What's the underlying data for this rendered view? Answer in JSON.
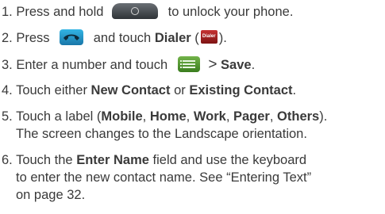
{
  "steps": [
    {
      "number": "1.",
      "before": "Press and hold",
      "after": "to unlock your phone.",
      "icon": "unlock-button-icon"
    },
    {
      "number": "2.",
      "before": "Press",
      "middle": "and touch",
      "bold": "Dialer",
      "paren_open": "(",
      "icon_label": "Dialer",
      "paren_close": ").",
      "icon": "phone-call-icon"
    },
    {
      "number": "3.",
      "before": "Enter a number and touch",
      "gt": ">",
      "bold": "Save",
      "period": ".",
      "icon": "menu-icon"
    },
    {
      "number": "4.",
      "before": "Touch either",
      "bold1": "New Contact",
      "middle": "or",
      "bold2": "Existing Contact",
      "period": "."
    },
    {
      "number": "5.",
      "before": "Touch a label (",
      "bold1": "Mobile",
      "sep1": ",",
      "bold2": "Home",
      "sep2": ",",
      "bold3": "Work",
      "sep3": ",",
      "bold4": "Pager",
      "sep4": ",",
      "bold5": "Others",
      "close": ").",
      "line2": "The screen changes to the Landscape orientation."
    },
    {
      "number": "6.",
      "before": "Touch the",
      "bold": "Enter Name",
      "after": "field and use the keyboard",
      "line2": "to enter the new contact name. See “Entering Text”",
      "line3": "on page 32."
    }
  ],
  "colors": {
    "text": "#3a3a3a",
    "phone_button": "#1976a8",
    "menu_button": "#3a7d1e",
    "dialer_icon": "#c73232"
  }
}
